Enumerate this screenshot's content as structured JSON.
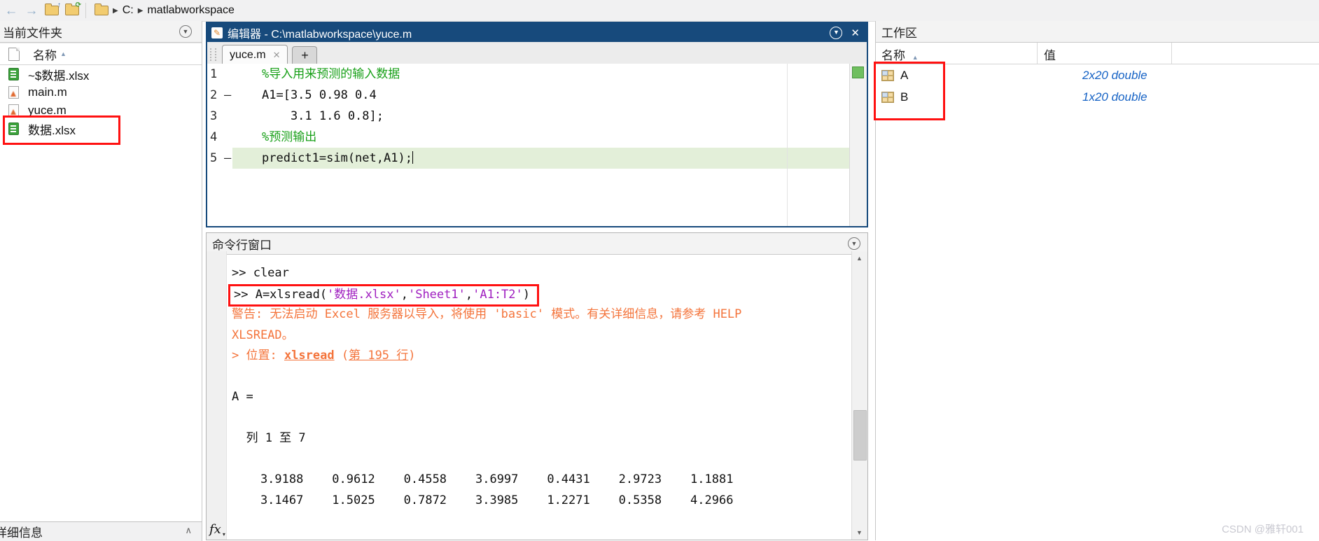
{
  "toolbar": {
    "back_icon": "left-arrow",
    "forward_icon": "right-arrow",
    "up_folder_icon": "folder-up",
    "browse_folder_icon": "folder-browse",
    "location_folder_icon": "folder",
    "breadcrumb": {
      "drive": "C:",
      "folder": "matlabworkspace"
    }
  },
  "current_folder": {
    "title": "当前文件夹",
    "name_column": "名称",
    "files": [
      {
        "name": "~$数据.xlsx",
        "icon": "excel-file-icon",
        "boxed": false
      },
      {
        "name": "main.m",
        "icon": "matlab-file-icon",
        "boxed": false
      },
      {
        "name": "yuce.m",
        "icon": "matlab-file-icon",
        "boxed": false
      },
      {
        "name": "数据.xlsx",
        "icon": "excel-file-icon",
        "boxed": true
      }
    ],
    "details_label": "详细信息"
  },
  "editor": {
    "title": "编辑器 - C:\\matlabworkspace\\yuce.m",
    "tab_label": "yuce.m",
    "new_tab_label": "+",
    "lines": [
      {
        "num": "1",
        "dash": false,
        "current": false,
        "cursor": false,
        "segments": [
          {
            "t": "%导入用来预测的输入数据",
            "c": "comment"
          }
        ]
      },
      {
        "num": "2",
        "dash": true,
        "current": false,
        "cursor": false,
        "segments": [
          {
            "t": "A1=[3.5 0.98 0.4",
            "c": "code"
          }
        ]
      },
      {
        "num": "3",
        "dash": false,
        "current": false,
        "cursor": false,
        "segments": [
          {
            "t": "    3.1 1.6 0.8];",
            "c": "code"
          }
        ]
      },
      {
        "num": "4",
        "dash": false,
        "current": false,
        "cursor": false,
        "segments": [
          {
            "t": "%预测输出",
            "c": "comment"
          }
        ]
      },
      {
        "num": "5",
        "dash": true,
        "current": true,
        "cursor": true,
        "segments": [
          {
            "t": "predict1=sim(net,A1);",
            "c": "code"
          }
        ]
      }
    ]
  },
  "command_window": {
    "title": "命令行窗口",
    "fx_label": "fx",
    "lines": [
      {
        "boxed": false,
        "segments": [
          {
            "t": ">> clear",
            "c": "plain"
          }
        ]
      },
      {
        "boxed": true,
        "segments": [
          {
            "t": ">> A=xlsread(",
            "c": "plain"
          },
          {
            "t": "'数据.xlsx'",
            "c": "string"
          },
          {
            "t": ",",
            "c": "plain"
          },
          {
            "t": "'Sheet1'",
            "c": "string"
          },
          {
            "t": ",",
            "c": "plain"
          },
          {
            "t": "'A1:T2'",
            "c": "string"
          },
          {
            "t": ")",
            "c": "plain"
          }
        ]
      },
      {
        "boxed": false,
        "segments": [
          {
            "t": "警告: 无法启动 Excel 服务器以导入，将使用 'basic' 模式。有关详细信息，请参考 HELP",
            "c": "warn"
          }
        ]
      },
      {
        "boxed": false,
        "segments": [
          {
            "t": "XLSREAD。",
            "c": "warn"
          }
        ]
      },
      {
        "boxed": false,
        "segments": [
          {
            "t": "> 位置: ",
            "c": "warn"
          },
          {
            "t": "xlsread",
            "c": "warnlinkbold"
          },
          {
            "t": " (",
            "c": "warn"
          },
          {
            "t": "第 195 行",
            "c": "warnlink"
          },
          {
            "t": ")",
            "c": "warn"
          }
        ]
      },
      {
        "boxed": false,
        "segments": []
      },
      {
        "boxed": false,
        "segments": [
          {
            "t": "A =",
            "c": "plain"
          }
        ]
      },
      {
        "boxed": false,
        "segments": []
      },
      {
        "boxed": false,
        "segments": [
          {
            "t": "  列 1 至 7",
            "c": "plain"
          }
        ]
      },
      {
        "boxed": false,
        "segments": []
      },
      {
        "boxed": false,
        "segments": [
          {
            "t": "    3.9188    0.9612    0.4558    3.6997    0.4431    2.9723    1.1881",
            "c": "plain"
          }
        ]
      },
      {
        "boxed": false,
        "segments": [
          {
            "t": "    3.1467    1.5025    0.7872    3.3985    1.2271    0.5358    4.2966",
            "c": "plain"
          }
        ]
      }
    ]
  },
  "workspace": {
    "title": "工作区",
    "columns": {
      "name": "名称",
      "value": "值"
    },
    "variables": [
      {
        "name": "A",
        "value": "2x20 double"
      },
      {
        "name": "B",
        "value": "1x20 double"
      }
    ]
  },
  "watermark": "CSDN @雅轩001",
  "colors": {
    "editor_titlebar": "#174a7c",
    "comment_green": "#18a018",
    "string_purple": "#a020c0",
    "warning_orange": "#f4743b",
    "workspace_value_blue": "#1562c5",
    "annotation_red": "#ff1111",
    "current_line_green": "#e3efd9"
  }
}
